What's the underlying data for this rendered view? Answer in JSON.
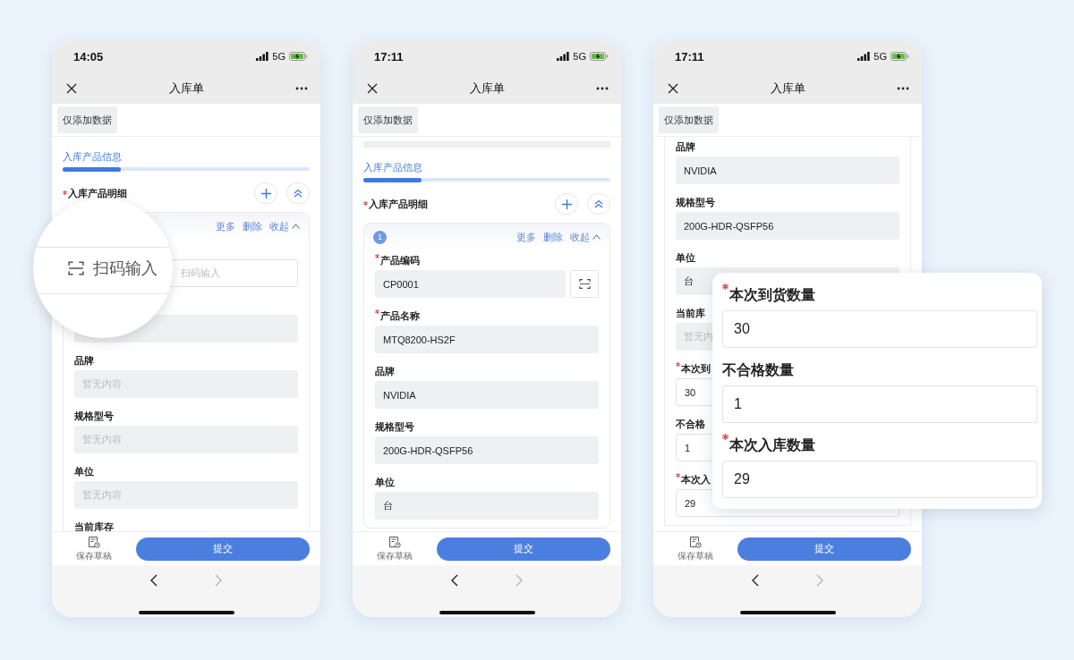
{
  "phones": [
    {
      "status": {
        "time": "14:05",
        "network": "5G"
      },
      "nav": {
        "title": "入库单",
        "back_disabled": false,
        "forward_disabled": true
      },
      "toolbar_button": "仅添加数据",
      "content": [
        {
          "kind": "tab",
          "label": "入库产品信息",
          "selected": true
        },
        {
          "kind": "group",
          "label": "入库产品明细",
          "required": true
        },
        {
          "kind": "card",
          "actions": [
            "更多",
            "删除",
            "收起"
          ],
          "fields": [
            {
              "kind": "scan_entry",
              "editable": true,
              "scan_button": false,
              "placeholder": "扫码输入"
            },
            {
              "kind": "text",
              "editable": false,
              "scan_button": false
            },
            {
              "kind": "text",
              "label": "品牌",
              "required": false,
              "editable": false,
              "scan_button": false,
              "placeholder": "暂无内容"
            },
            {
              "kind": "text",
              "label": "规格型号",
              "required": false,
              "editable": false,
              "scan_button": false,
              "placeholder": "暂无内容"
            },
            {
              "kind": "text",
              "label": "单位",
              "required": false,
              "editable": false,
              "scan_button": false,
              "placeholder": "暂无内容"
            },
            {
              "kind": "text",
              "label": "当前库存",
              "required": false
            }
          ]
        }
      ],
      "magnifier": {
        "text": "扫码输入"
      },
      "footer": {
        "draft": "保存草稿",
        "submit": "提交"
      }
    },
    {
      "status": {
        "time": "17:11",
        "network": "5G"
      },
      "nav": {
        "title": "入库单",
        "back_disabled": false,
        "forward_disabled": true
      },
      "toolbar_button": "仅添加数据",
      "content": [
        {
          "kind": "strip"
        },
        {
          "kind": "tab",
          "label": "入库产品信息",
          "selected": true
        },
        {
          "kind": "group",
          "label": "入库产品明细",
          "required": true
        },
        {
          "kind": "card",
          "index": "1",
          "actions": [
            "更多",
            "删除",
            "收起"
          ],
          "fields": [
            {
              "kind": "text",
              "label": "产品编码",
              "required": true,
              "editable": false,
              "scan_button": true,
              "value": "CP0001"
            },
            {
              "kind": "text",
              "label": "产品名称",
              "required": true,
              "editable": false,
              "scan_button": false,
              "value": "MTQ8200-HS2F"
            },
            {
              "kind": "text",
              "label": "品牌",
              "required": false,
              "editable": false,
              "scan_button": false,
              "value": "NVIDIA"
            },
            {
              "kind": "text",
              "label": "规格型号",
              "required": false,
              "editable": false,
              "scan_button": false,
              "value": "200G-HDR-QSFP56"
            },
            {
              "kind": "text",
              "label": "单位",
              "required": false,
              "editable": false,
              "scan_button": false,
              "value": "台"
            }
          ]
        }
      ],
      "footer": {
        "draft": "保存草稿",
        "submit": "提交"
      }
    },
    {
      "status": {
        "time": "17:11",
        "network": "5G"
      },
      "nav": {
        "title": "入库单",
        "back_disabled": false,
        "forward_disabled": true
      },
      "toolbar_button": "仅添加数据",
      "content": [
        {
          "kind": "card",
          "fields": [
            {
              "kind": "text",
              "label": "品牌",
              "required": false,
              "editable": false,
              "scan_button": false,
              "value": "NVIDIA"
            },
            {
              "kind": "text",
              "label": "规格型号",
              "required": false,
              "editable": false,
              "scan_button": false,
              "value": "200G-HDR-QSFP56"
            },
            {
              "kind": "text",
              "label": "单位",
              "required": false,
              "editable": false,
              "scan_button": false,
              "value": "台"
            },
            {
              "kind": "text",
              "label": "当前库",
              "required": false,
              "editable": false,
              "scan_button": false,
              "placeholder": "暂无内"
            },
            {
              "kind": "text",
              "label": "本次到",
              "required": true,
              "editable": true,
              "scan_button": false,
              "value": "30"
            },
            {
              "kind": "text",
              "label": "不合格",
              "required": false,
              "editable": true,
              "scan_button": false,
              "value": "1"
            },
            {
              "kind": "text",
              "label": "本次入",
              "required": true,
              "editable": true,
              "scan_button": false,
              "value": "29"
            }
          ]
        }
      ],
      "overlay": {
        "fields": [
          {
            "label": "本次到货数量",
            "required": true,
            "value": "30"
          },
          {
            "label": "不合格数量",
            "required": false,
            "value": "1"
          },
          {
            "label": "本次入库数量",
            "required": true,
            "value": "29"
          }
        ]
      },
      "footer": {
        "draft": "保存草稿",
        "submit": "提交"
      }
    }
  ]
}
